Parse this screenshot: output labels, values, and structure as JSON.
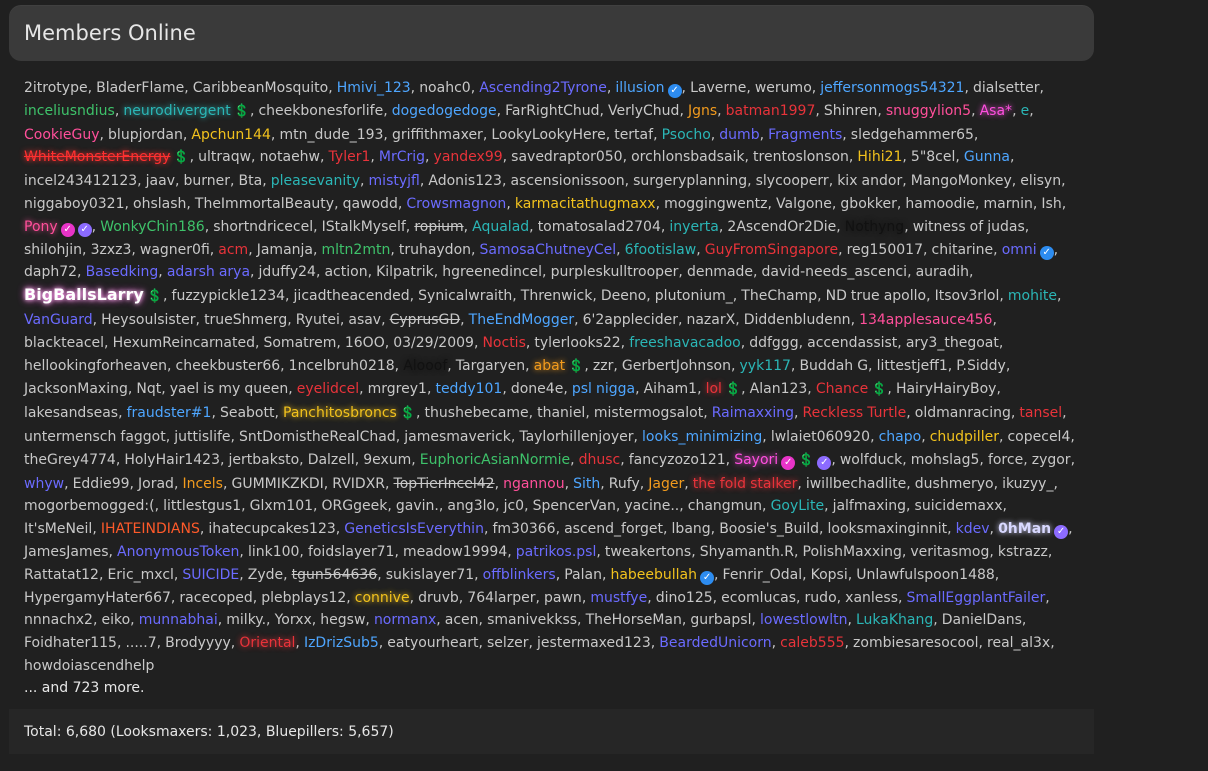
{
  "title": "Members Online",
  "more": "... and 723 more.",
  "total": "Total: 6,680 (Looksmaxers: 1,023, Bluepillers: 5,657)",
  "members": [
    {
      "n": "2itrotype"
    },
    {
      "n": "BladerFlame"
    },
    {
      "n": "CaribbeanMosquito"
    },
    {
      "n": "Hmivi_123",
      "c": "#4ea6ff"
    },
    {
      "n": "noahc0"
    },
    {
      "n": "Ascending2Tyrone",
      "c": "#6b6bff"
    },
    {
      "n": "illusion",
      "c": "#4ea6ff",
      "b": [
        "verified"
      ]
    },
    {
      "n": "Laverne"
    },
    {
      "n": "werumo"
    },
    {
      "n": "jeffersonmogs54321",
      "c": "#4ea6ff"
    },
    {
      "n": "dialsetter"
    },
    {
      "n": "inceliusndius",
      "c": "#3ec26a"
    },
    {
      "n": "neurodivergent",
      "c": "#2bb6b6",
      "g": true,
      "b": [
        "dollar"
      ]
    },
    {
      "n": "cheekbonesforlife"
    },
    {
      "n": "dogedogedoge",
      "c": "#4ea6ff"
    },
    {
      "n": "FarRightChud"
    },
    {
      "n": "VerlyChud"
    },
    {
      "n": "Jgns",
      "c": "#f29b1d"
    },
    {
      "n": "batman1997",
      "c": "#e8333a"
    },
    {
      "n": "Shinren"
    },
    {
      "n": "snuggylion5",
      "c": "#ff4f9a"
    },
    {
      "n": "Asa*",
      "c": "#ff4fe0",
      "g": true
    },
    {
      "n": "e",
      "c": "#2bb6b6"
    },
    {
      "n": "CookieGuy",
      "c": "#ff4f9a"
    },
    {
      "n": "blupjordan"
    },
    {
      "n": "Apchun144",
      "c": "#f2c21d"
    },
    {
      "n": "mtn_dude_193"
    },
    {
      "n": "griffithmaxer"
    },
    {
      "n": "LookyLookyHere"
    },
    {
      "n": "tertaf"
    },
    {
      "n": "Psocho",
      "c": "#2bb6b6"
    },
    {
      "n": "dumb",
      "c": "#6b6bff"
    },
    {
      "n": "Fragments",
      "c": "#6b6bff"
    },
    {
      "n": "sledgehammer65"
    },
    {
      "n": "WhiteMonsterEnergy",
      "c": "#ff3030",
      "g": true,
      "s": true,
      "b": [
        "dollar"
      ]
    },
    {
      "n": "ultraqw"
    },
    {
      "n": "notaehw"
    },
    {
      "n": "Tyler1",
      "c": "#e8333a"
    },
    {
      "n": "MrCrig",
      "c": "#6b6bff"
    },
    {
      "n": "yandex99",
      "c": "#e8333a"
    },
    {
      "n": "savedraptor050"
    },
    {
      "n": "orchlonsbadsaik"
    },
    {
      "n": "trentoslonson"
    },
    {
      "n": "Hihi21",
      "c": "#f2c21d"
    },
    {
      "n": "5\"8cel"
    },
    {
      "n": "Gunna",
      "c": "#4ea6ff"
    },
    {
      "n": "incel243412123"
    },
    {
      "n": "jaav"
    },
    {
      "n": "burner"
    },
    {
      "n": "Bta"
    },
    {
      "n": "pleasevanity",
      "c": "#2bb6b6"
    },
    {
      "n": "mistyjfl",
      "c": "#6b6bff"
    },
    {
      "n": "Adonis123"
    },
    {
      "n": "ascensionissoon"
    },
    {
      "n": "surgeryplanning"
    },
    {
      "n": "slycooperr"
    },
    {
      "n": "kix andor"
    },
    {
      "n": "MangoMonkey"
    },
    {
      "n": "elisyn"
    },
    {
      "n": "niggaboy0321"
    },
    {
      "n": "ohslash"
    },
    {
      "n": "TheImmortalBeauty"
    },
    {
      "n": "qawodd"
    },
    {
      "n": "Crowsmagnon",
      "c": "#6b6bff"
    },
    {
      "n": "karmacitathugmaxx",
      "c": "#f2c21d"
    },
    {
      "n": "moggingwentz"
    },
    {
      "n": "Valgone"
    },
    {
      "n": "gbokker"
    },
    {
      "n": "hamoodie"
    },
    {
      "n": "marnin"
    },
    {
      "n": "Ish"
    },
    {
      "n": "Pony",
      "c": "#ff4f9a",
      "g": true,
      "b": [
        "pink",
        "verified-purple"
      ]
    },
    {
      "n": "WonkyChin186",
      "c": "#3ec26a"
    },
    {
      "n": "shortndricecel"
    },
    {
      "n": "IStalkMyself"
    },
    {
      "n": "ropium",
      "s": true
    },
    {
      "n": "Aqualad",
      "c": "#2bb6b6"
    },
    {
      "n": "tomatosalad2704"
    },
    {
      "n": "inyerta",
      "c": "#2bb6b6"
    },
    {
      "n": "2AscendOr2Die"
    },
    {
      "n": "Nothyng",
      "c": "#111111",
      "g": true
    },
    {
      "n": "witness of judas"
    },
    {
      "n": "shilohjin"
    },
    {
      "n": "3zxz3"
    },
    {
      "n": "wagner0fi"
    },
    {
      "n": "acm",
      "c": "#e8333a"
    },
    {
      "n": "Jamanja"
    },
    {
      "n": "mltn2mtn",
      "c": "#3ec26a"
    },
    {
      "n": "truhaydon"
    },
    {
      "n": "SamosaChutneyCel",
      "c": "#6b6bff"
    },
    {
      "n": "6footislaw",
      "c": "#2bb6b6"
    },
    {
      "n": "GuyFromSingapore",
      "c": "#e8333a"
    },
    {
      "n": "reg150017"
    },
    {
      "n": "chitarine"
    },
    {
      "n": "omni",
      "c": "#6b6bff",
      "b": [
        "verified"
      ]
    },
    {
      "n": "daph72"
    },
    {
      "n": "Basedking",
      "c": "#6b6bff"
    },
    {
      "n": "adarsh arya",
      "c": "#6b6bff"
    },
    {
      "n": "jduffy24"
    },
    {
      "n": "action"
    },
    {
      "n": "Kilpatrik"
    },
    {
      "n": "hgreenedincel"
    },
    {
      "n": "purpleskulltrooper"
    },
    {
      "n": "denmade"
    },
    {
      "n": "david-needs_ascenci"
    },
    {
      "n": "auradih"
    },
    {
      "n": "BigBallsLarry",
      "c": "#ffffff",
      "g": true,
      "big": true,
      "b": [
        "dollar"
      ]
    },
    {
      "n": "fuzzypickle1234"
    },
    {
      "n": "jicadtheacended"
    },
    {
      "n": "Synicalwraith"
    },
    {
      "n": "Threnwick"
    },
    {
      "n": "Deeno"
    },
    {
      "n": "plutonium_"
    },
    {
      "n": "TheChamp"
    },
    {
      "n": "ND true apollo"
    },
    {
      "n": "Itsov3rlol"
    },
    {
      "n": "mohite",
      "c": "#2bb6b6"
    },
    {
      "n": "VanGuard",
      "c": "#6b6bff"
    },
    {
      "n": "Heysoulsister"
    },
    {
      "n": "trueShmerg"
    },
    {
      "n": "Ryutei"
    },
    {
      "n": "asav"
    },
    {
      "n": "CyprusGD",
      "s": true
    },
    {
      "n": "TheEndMogger",
      "c": "#4ea6ff"
    },
    {
      "n": "6'2applecider"
    },
    {
      "n": "nazarX"
    },
    {
      "n": "Diddenbludenn"
    },
    {
      "n": "134applesauce456",
      "c": "#ff4f9a"
    },
    {
      "n": "blackteacel"
    },
    {
      "n": "HexumReincarnated"
    },
    {
      "n": "Somatrem"
    },
    {
      "n": "16OO"
    },
    {
      "n": "03/29/2009"
    },
    {
      "n": "Noctis",
      "c": "#e8333a"
    },
    {
      "n": "tylerlooks22"
    },
    {
      "n": "freeshavacadoo",
      "c": "#2bb6b6"
    },
    {
      "n": "ddfggg"
    },
    {
      "n": "accendassist"
    },
    {
      "n": "ary3_thegoat"
    },
    {
      "n": "hellookingforheaven"
    },
    {
      "n": "cheekbuster66"
    },
    {
      "n": "1ncelbruh0218"
    },
    {
      "n": "Alooof",
      "c": "#111111",
      "g": true
    },
    {
      "n": "Targaryen"
    },
    {
      "n": "abat",
      "c": "#f29b1d",
      "g": true,
      "b": [
        "dollar"
      ]
    },
    {
      "n": "zzr"
    },
    {
      "n": "GerbertJohnson"
    },
    {
      "n": "yyk117",
      "c": "#2bb6b6"
    },
    {
      "n": "Buddah G"
    },
    {
      "n": "littestjeff1"
    },
    {
      "n": "P.Siddy"
    },
    {
      "n": "JacksonMaxing"
    },
    {
      "n": "Nqt"
    },
    {
      "n": "yael is my queen"
    },
    {
      "n": "eyelidcel",
      "c": "#e8333a"
    },
    {
      "n": "mrgrey1"
    },
    {
      "n": "teddy101",
      "c": "#4ea6ff"
    },
    {
      "n": "done4e"
    },
    {
      "n": "psl nigga",
      "c": "#4ea6ff"
    },
    {
      "n": "Aiham1"
    },
    {
      "n": "lol",
      "c": "#e8333a",
      "g": true,
      "b": [
        "dollar"
      ]
    },
    {
      "n": "Alan123"
    },
    {
      "n": "Chance",
      "c": "#e8333a",
      "b": [
        "dollar"
      ]
    },
    {
      "n": "HairyHairyBoy"
    },
    {
      "n": "lakesandseas"
    },
    {
      "n": "fraudster#1",
      "c": "#4ea6ff"
    },
    {
      "n": "Seabott"
    },
    {
      "n": "Panchitosbroncs",
      "c": "#f2c21d",
      "g": true,
      "b": [
        "dollar"
      ]
    },
    {
      "n": "thushebecame"
    },
    {
      "n": "thaniel"
    },
    {
      "n": "mistermogsalot"
    },
    {
      "n": "Raimaxxing",
      "c": "#6b6bff"
    },
    {
      "n": "Reckless Turtle",
      "c": "#e8333a"
    },
    {
      "n": "oldmanracing"
    },
    {
      "n": "tansel",
      "c": "#e8333a"
    },
    {
      "n": "untermensch faggot"
    },
    {
      "n": "juttislife"
    },
    {
      "n": "SntDomistheRealChad"
    },
    {
      "n": "jamesmaverick"
    },
    {
      "n": "Taylorhillenjoyer"
    },
    {
      "n": "looks_minimizing",
      "c": "#4ea6ff"
    },
    {
      "n": "lwlaiet060920"
    },
    {
      "n": "chapo",
      "c": "#4ea6ff"
    },
    {
      "n": "chudpiller",
      "c": "#f2c21d"
    },
    {
      "n": "copecel4"
    },
    {
      "n": "theGrey4774"
    },
    {
      "n": "HolyHair1423"
    },
    {
      "n": "jertbaksto"
    },
    {
      "n": "Dalzell"
    },
    {
      "n": "9exum"
    },
    {
      "n": "EuphoricAsianNormie",
      "c": "#3ec26a"
    },
    {
      "n": "dhusc",
      "c": "#e8333a"
    },
    {
      "n": "fancyzozo121"
    },
    {
      "n": "Sayori",
      "c": "#ff4fe0",
      "g": true,
      "b": [
        "pink",
        "dollar",
        "verified-purple"
      ]
    },
    {
      "n": "wolfduck"
    },
    {
      "n": "mohslag5"
    },
    {
      "n": "force"
    },
    {
      "n": "zygor"
    },
    {
      "n": "whyw",
      "c": "#6b6bff"
    },
    {
      "n": "Eddie99"
    },
    {
      "n": "Jorad"
    },
    {
      "n": "Incels",
      "c": "#f29b1d"
    },
    {
      "n": "GUMMIKZKDI"
    },
    {
      "n": "RVIDXR"
    },
    {
      "n": "TopTierIncel42",
      "s": true
    },
    {
      "n": "ngannou",
      "c": "#ff4f9a"
    },
    {
      "n": "Sith",
      "c": "#4ea6ff"
    },
    {
      "n": "Rufy"
    },
    {
      "n": "Jager",
      "c": "#f29b1d"
    },
    {
      "n": "the fold stalker",
      "c": "#e8333a",
      "g": true
    },
    {
      "n": "iwillbechadlite"
    },
    {
      "n": "dushmeryo"
    },
    {
      "n": "ikuzyy_"
    },
    {
      "n": "mogorbemogged:("
    },
    {
      "n": "littlestgus1"
    },
    {
      "n": "Glxm101"
    },
    {
      "n": "ORGgeek"
    },
    {
      "n": "gavin."
    },
    {
      "n": "ang3lo"
    },
    {
      "n": "jc0"
    },
    {
      "n": "SpencerVan"
    },
    {
      "n": "yacine.."
    },
    {
      "n": "changmun"
    },
    {
      "n": "GoyLite",
      "c": "#2bb6b6"
    },
    {
      "n": "jalfmaxing"
    },
    {
      "n": "suicidemaxx"
    },
    {
      "n": "It'sMeNeil"
    },
    {
      "n": "IHATEINDIANS",
      "c": "#ff5a2a"
    },
    {
      "n": "ihatecupcakes123"
    },
    {
      "n": "GeneticsIsEverythin",
      "c": "#6b6bff"
    },
    {
      "n": "fm30366"
    },
    {
      "n": "ascend_forget"
    },
    {
      "n": "lbang"
    },
    {
      "n": "Boosie's_Build"
    },
    {
      "n": "looksmaxinginnit"
    },
    {
      "n": "kdev",
      "c": "#6b6bff"
    },
    {
      "n": "0hMan",
      "c": "#d8d8ff",
      "g": true,
      "bold": true,
      "b": [
        "verified-purple"
      ]
    },
    {
      "n": "JamesJames"
    },
    {
      "n": "AnonymousToken",
      "c": "#6b6bff"
    },
    {
      "n": "link100"
    },
    {
      "n": "foidslayer71"
    },
    {
      "n": "meadow19994"
    },
    {
      "n": "patrikos.psl",
      "c": "#6b6bff"
    },
    {
      "n": "tweakertons"
    },
    {
      "n": "Shyamanth.R"
    },
    {
      "n": "PolishMaxxing"
    },
    {
      "n": "veritasmog"
    },
    {
      "n": "kstrazz"
    },
    {
      "n": "Rattatat12"
    },
    {
      "n": "Eric_mxcl"
    },
    {
      "n": "SUICIDE",
      "c": "#6b6bff"
    },
    {
      "n": "Zyde"
    },
    {
      "n": "tgun564636",
      "s": true
    },
    {
      "n": "sukislayer71"
    },
    {
      "n": "offblinkers",
      "c": "#6b6bff"
    },
    {
      "n": "Palan"
    },
    {
      "n": "habeebullah",
      "c": "#f2c21d",
      "b": [
        "verified"
      ]
    },
    {
      "n": "Fenrir_Odal"
    },
    {
      "n": "Kopsi"
    },
    {
      "n": "Unlawfulspoon1488"
    },
    {
      "n": "HypergamyHater667"
    },
    {
      "n": "racecoped"
    },
    {
      "n": "plebplays12"
    },
    {
      "n": "connive",
      "c": "#f2c21d",
      "g": true
    },
    {
      "n": "druvb"
    },
    {
      "n": "764larper"
    },
    {
      "n": "pawn"
    },
    {
      "n": "mustfye",
      "c": "#6b6bff"
    },
    {
      "n": "dino125"
    },
    {
      "n": "ecomlucas"
    },
    {
      "n": "rudo"
    },
    {
      "n": "xanless"
    },
    {
      "n": "SmallEggplantFailer",
      "c": "#6b6bff"
    },
    {
      "n": "nnnachx2"
    },
    {
      "n": "eiko"
    },
    {
      "n": "munnabhai",
      "c": "#6b6bff"
    },
    {
      "n": "milky."
    },
    {
      "n": "Yorxx"
    },
    {
      "n": "hegsw"
    },
    {
      "n": "normanx",
      "c": "#6b6bff"
    },
    {
      "n": "acen"
    },
    {
      "n": "smanivekkss"
    },
    {
      "n": "TheHorseMan"
    },
    {
      "n": "gurbapsl"
    },
    {
      "n": "lowestlowltn",
      "c": "#6b6bff"
    },
    {
      "n": "LukaKhang",
      "c": "#2bb6b6"
    },
    {
      "n": "DanielDans"
    },
    {
      "n": "Foidhater115"
    },
    {
      "n": ".....7"
    },
    {
      "n": "Brodyyyy"
    },
    {
      "n": "Oriental",
      "c": "#e8333a",
      "g": true
    },
    {
      "n": "IzDrizSub5",
      "c": "#4ea6ff"
    },
    {
      "n": "eatyourheart"
    },
    {
      "n": "selzer"
    },
    {
      "n": "jestermaxed123"
    },
    {
      "n": "BeardedUnicorn",
      "c": "#6b6bff"
    },
    {
      "n": "caleb555",
      "c": "#e8333a"
    },
    {
      "n": "zombiesaresocool"
    },
    {
      "n": "real_al3x"
    },
    {
      "n": "howdoiascendhelp"
    }
  ]
}
